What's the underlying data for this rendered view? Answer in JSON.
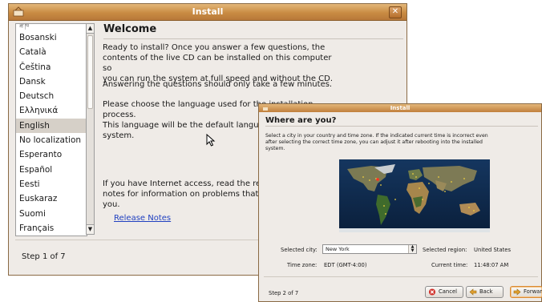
{
  "window1": {
    "title": "Install",
    "close_glyph": "✕",
    "languages_top_partial": "ཟོ་ཁ",
    "languages": [
      "Bosanski",
      "Català",
      "Čeština",
      "Dansk",
      "Deutsch",
      "Ελληνικά",
      "English",
      "No localization",
      "Esperanto",
      "Español",
      "Eesti",
      "Euskaraz",
      "Suomi",
      "Français"
    ],
    "selected_language": "English",
    "heading": "Welcome",
    "para1_line1": "Ready to install? Once you answer a few questions, the",
    "para1_line2": "contents of the live CD can be installed on this computer so",
    "para1_line3": "you can run the system at full speed and without the CD.",
    "para2": "Answering the questions should only take a few minutes.",
    "para3_line1": "Please choose the language used for the installation process.",
    "para3_line2": "This language will be the default language for the final system.",
    "para4_line1": "If you have Internet access, read the release notes for",
    "para4_line2": "notes for information on problems that may affect",
    "para4_line3": "you.",
    "link": "Release Notes",
    "step": "Step 1 of 7"
  },
  "window2": {
    "title": "Install",
    "heading": "Where are you?",
    "desc_line1": "Select a city in your country and time zone. If the indicated current time is incorrect even",
    "desc_line2": "after selecting the correct time zone, you can adjust it after rebooting into the installed",
    "desc_line3": "system.",
    "city_label": "Selected city:",
    "city_value": "New York",
    "region_label": "Selected region:",
    "region_value": "United States",
    "tz_label": "Time zone:",
    "tz_value": "EDT (GMT-4:00)",
    "time_label": "Current time:",
    "time_value": "11:48:07 AM",
    "step": "Step 2 of 7",
    "cancel_label": "Cancel",
    "back_label": "Back",
    "forward_label": "Forward"
  },
  "colors": {
    "titlebar": "#c98b43",
    "selection": "#d6d0c8",
    "link": "#2040c0"
  }
}
